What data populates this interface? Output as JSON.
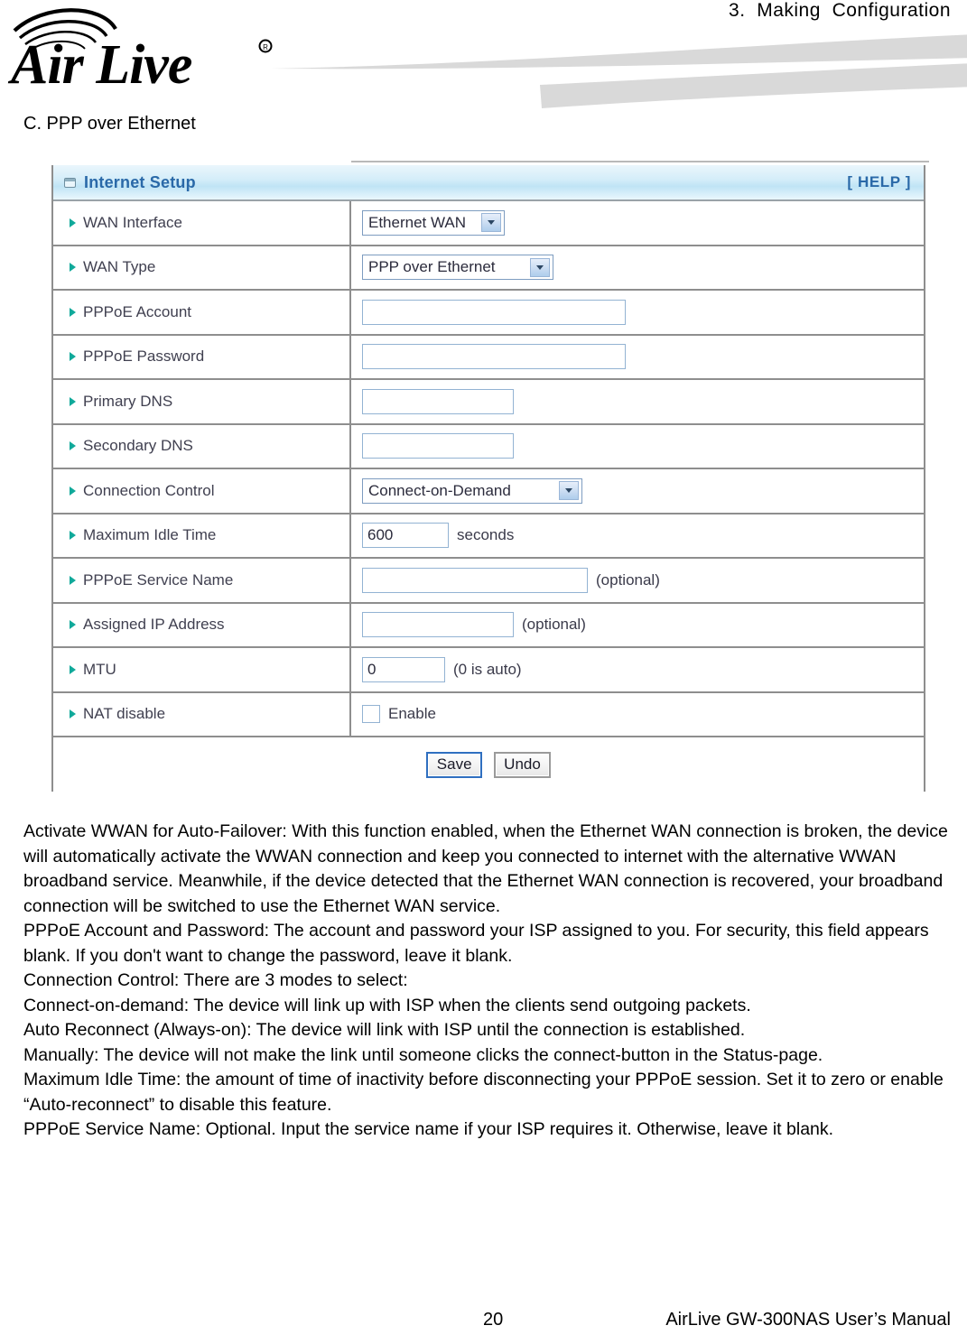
{
  "header": {
    "chapter": "3.  Making  Configuration",
    "logo_text": "Air Live",
    "logo_mark": "registered-trademark"
  },
  "section": {
    "caption": "C. PPP over Ethernet"
  },
  "panel": {
    "title": "Internet Setup",
    "help_label": "[ HELP ]",
    "title_icon": "window-icon",
    "rows": [
      {
        "label": "WAN Interface",
        "control": "select",
        "value": "Ethernet WAN"
      },
      {
        "label": "WAN Type",
        "control": "select",
        "value": "PPP over Ethernet"
      },
      {
        "label": "PPPoE Account",
        "control": "text",
        "value": ""
      },
      {
        "label": "PPPoE Password",
        "control": "text",
        "value": ""
      },
      {
        "label": "Primary DNS",
        "control": "text",
        "value": ""
      },
      {
        "label": "Secondary DNS",
        "control": "text",
        "value": ""
      },
      {
        "label": "Connection Control",
        "control": "select",
        "value": "Connect-on-Demand"
      },
      {
        "label": "Maximum Idle Time",
        "control": "text",
        "value": "600",
        "suffix": "seconds"
      },
      {
        "label": "PPPoE Service Name",
        "control": "text",
        "value": "",
        "suffix": "(optional)"
      },
      {
        "label": "Assigned IP Address",
        "control": "text",
        "value": "",
        "suffix": "(optional)"
      },
      {
        "label": "MTU",
        "control": "text",
        "value": "0",
        "suffix": "(0 is auto)"
      },
      {
        "label": "NAT disable",
        "control": "checkbox",
        "value": "",
        "suffix": "Enable",
        "checked": false
      }
    ],
    "buttons": {
      "save": "Save",
      "undo": "Undo"
    },
    "colors": {
      "title_blue": "#2a69a8",
      "head_gradient_top": "#eaf6fc",
      "head_gradient_mid": "#bfe4f5",
      "bullet_teal": "#10a99a",
      "border_gray": "#8e8e8e",
      "field_border_blue": "#93b3d3",
      "save_border_blue": "#2f6fc0"
    }
  },
  "prose": {
    "p1": "Activate WWAN for Auto-Failover: With this function enabled, when the Ethernet WAN connection is broken, the device will automatically activate the WWAN connection and keep you connected to internet with the alternative WWAN broadband service. Meanwhile, if the device detected that the Ethernet WAN connection is recovered, your broadband connection will be switched to use the Ethernet WAN service.",
    "p2": "PPPoE Account and Password: The account and password your ISP assigned to you. For security, this field appears blank. If you don't want to change the password, leave it blank.",
    "p3": "Connection Control: There are 3 modes to select:",
    "p4": "Connect-on-demand: The device will link up with ISP when the clients send outgoing packets.",
    "p5": "Auto Reconnect (Always-on): The device will link with ISP until the connection is established.",
    "p6": "Manually: The device will not make the link until someone clicks the connect-button in the Status-page.",
    "p7": "Maximum Idle Time: the amount of time of inactivity before disconnecting your PPPoE session. Set it to zero or enable “Auto-reconnect” to disable this feature.",
    "p8": "PPPoE Service Name: Optional. Input the service name if your ISP requires it. Otherwise, leave it blank."
  },
  "footer": {
    "page_number": "20",
    "manual_title": "AirLive GW-300NAS User’s Manual"
  }
}
